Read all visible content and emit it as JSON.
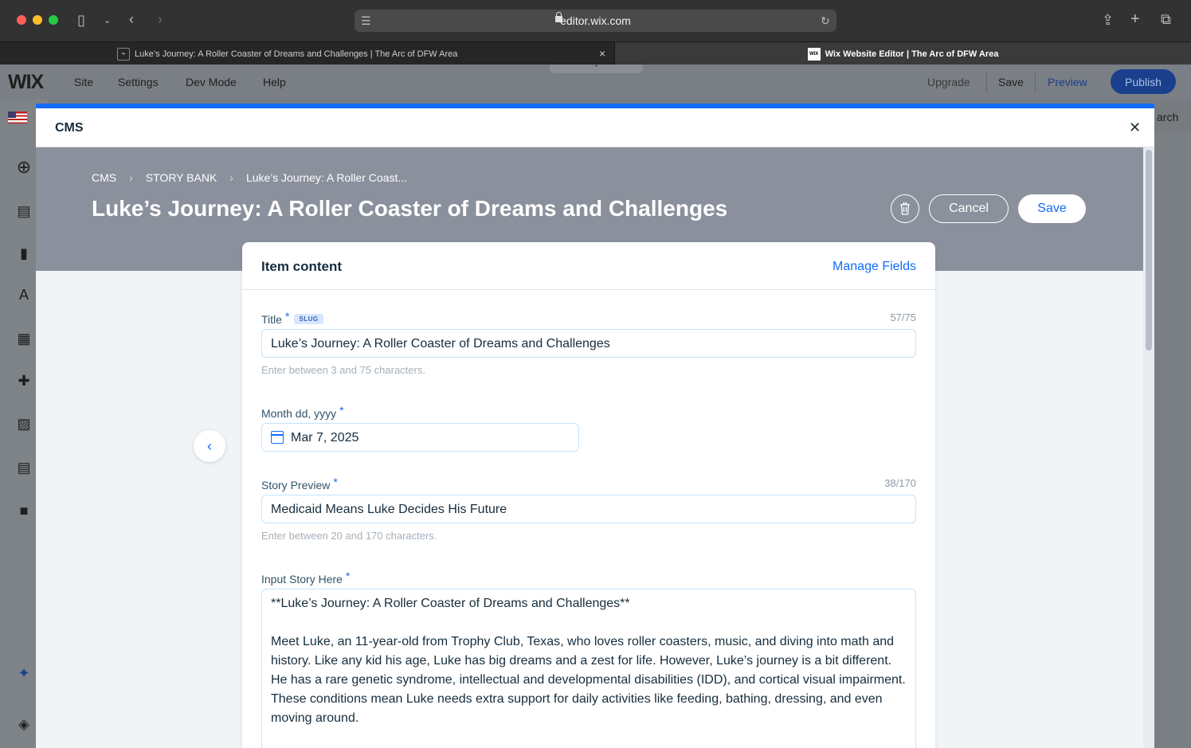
{
  "browser": {
    "url": "editor.wix.com",
    "tabs": [
      {
        "title": "Luke’s Journey: A Roller Coaster of Dreams and Challenges | The Arc of DFW Area"
      },
      {
        "title": "Wix Website Editor | The Arc of DFW Area"
      }
    ]
  },
  "editor": {
    "logo": "WIX",
    "menu": [
      "Site",
      "Settings",
      "Dev Mode",
      "Help"
    ],
    "upgrade": "Upgrade",
    "save": "Save",
    "preview": "Preview",
    "publish": "Publish",
    "right_search": "arch"
  },
  "modal": {
    "title": "CMS",
    "breadcrumb": [
      "CMS",
      "STORY BANK",
      "Luke’s Journey: A Roller Coast..."
    ],
    "page_title": "Luke’s Journey: A Roller Coaster of Dreams and Challenges",
    "cancel_label": "Cancel",
    "save_label": "Save",
    "card": {
      "title": "Item content",
      "manage_fields": "Manage Fields",
      "fields": {
        "title": {
          "label": "Title",
          "required": "*",
          "badge": "SLUG",
          "counter": "57/75",
          "value": "Luke’s Journey: A Roller Coaster of Dreams and Challenges",
          "hint": "Enter between 3 and 75 characters."
        },
        "date": {
          "label": "Month dd, yyyy",
          "required": "*",
          "value": "Mar 7, 2025"
        },
        "preview": {
          "label": "Story Preview",
          "required": "*",
          "counter": "38/170",
          "value": "Medicaid Means Luke Decides His Future",
          "hint": "Enter between 20 and 170 characters."
        },
        "story": {
          "label": "Input Story Here",
          "required": "*",
          "paragraphs": [
            "**Luke’s Journey: A Roller Coaster of Dreams and Challenges**",
            "Meet Luke, an 11-year-old from Trophy Club, Texas, who loves roller coasters, music, and diving into math and history. Like any kid his age, Luke has big dreams and a zest for life. However, Luke’s journey is a bit different. He has a rare genetic syndrome, intellectual and developmental disabilities (IDD), and cortical visual impairment. These conditions mean Luke needs extra support for daily activities like feeding, bathing, dressing, and even moving around."
          ]
        }
      }
    }
  }
}
